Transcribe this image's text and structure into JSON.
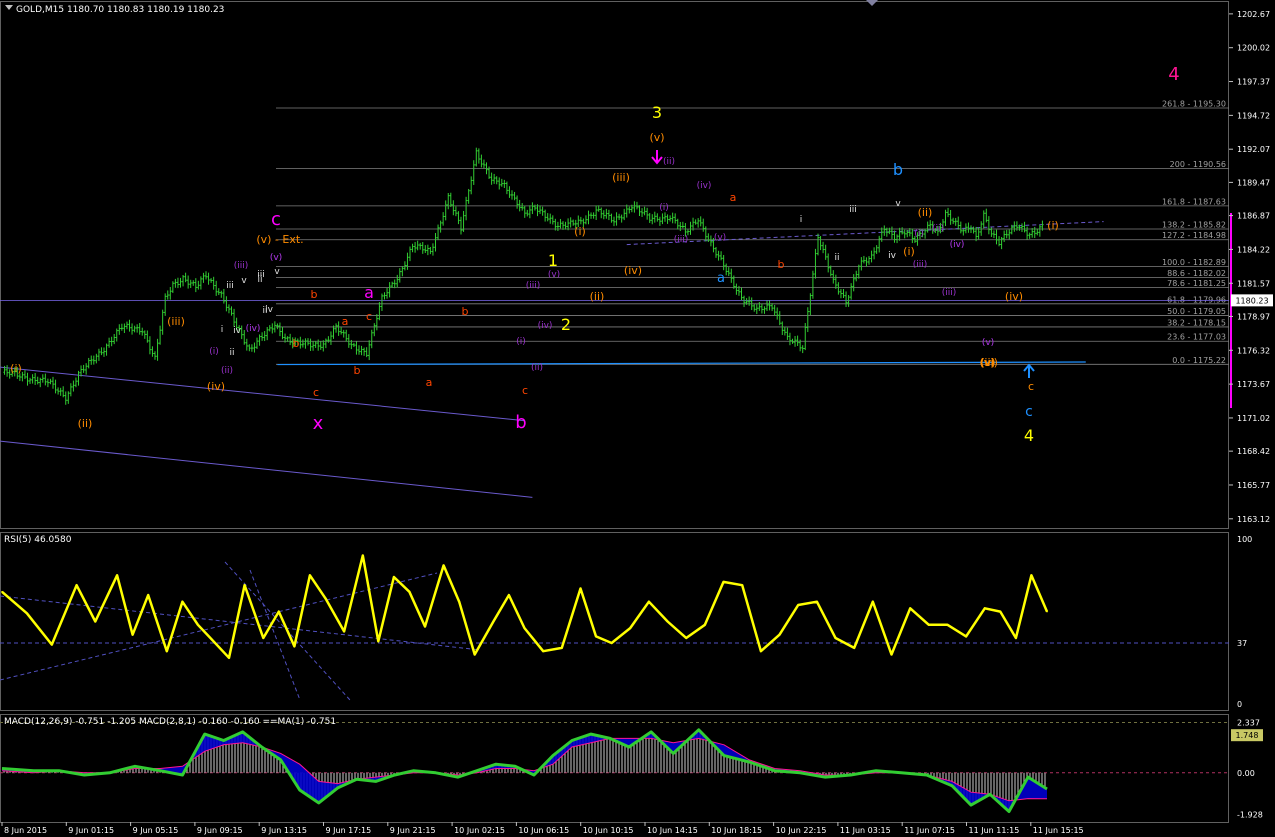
{
  "chart_data": [
    {
      "type": "candlestick",
      "title": "GOLD,M15  1180.70 1180.83 1180.19 1180.23",
      "symbol": "GOLD",
      "timeframe": "M15",
      "ohlc_header": {
        "open": 1180.7,
        "high": 1180.83,
        "low": 1180.19,
        "close": 1180.23
      },
      "current_price": 1180.23,
      "y_ticks": [
        1202.67,
        1200.02,
        1197.37,
        1194.72,
        1192.07,
        1189.47,
        1186.87,
        1184.22,
        1181.57,
        1178.97,
        1176.32,
        1173.67,
        1171.02,
        1168.42,
        1165.77,
        1163.12
      ],
      "ylim": [
        1162.4,
        1203.6
      ],
      "x_ticks": [
        "8 Jun 2015",
        "9 Jun 01:15",
        "9 Jun 05:15",
        "9 Jun 09:15",
        "9 Jun 13:15",
        "9 Jun 17:15",
        "9 Jun 21:15",
        "10 Jun 02:15",
        "10 Jun 06:15",
        "10 Jun 10:15",
        "10 Jun 14:15",
        "10 Jun 18:15",
        "10 Jun 22:15",
        "11 Jun 03:15",
        "11 Jun 07:15",
        "11 Jun 11:15",
        "11 Jun 15:15"
      ],
      "close_path_bar_index": [
        0,
        10,
        18,
        25,
        30,
        40,
        47,
        55,
        60,
        64,
        67,
        71,
        76,
        80,
        86,
        92,
        97,
        101,
        104,
        107,
        111,
        117,
        122,
        126,
        131,
        137,
        143,
        149,
        155,
        161,
        168,
        175,
        180,
        186,
        192,
        197,
        202,
        205,
        209,
        214,
        218,
        222,
        227,
        233,
        240,
        247,
        254,
        262,
        268,
        273,
        279,
        284,
        290,
        296,
        302,
        308,
        314,
        320,
        326,
        331,
        336,
        341,
        346,
        350,
        354,
        358,
        361,
        364,
        367,
        370,
        373,
        377,
        380,
        382,
        385,
        388,
        391,
        394,
        398,
        403,
        408
      ],
      "close_path_price": [
        1174.6,
        1174.2,
        1173.8,
        1172.7,
        1174.4,
        1176.5,
        1178.1,
        1178.0,
        1175.6,
        1180.3,
        1181.5,
        1182.0,
        1181.2,
        1182.2,
        1180.7,
        1178.1,
        1176.4,
        1177.3,
        1177.7,
        1178.2,
        1177.3,
        1176.9,
        1176.6,
        1176.8,
        1178.2,
        1176.6,
        1176.2,
        1180.3,
        1182.0,
        1184.5,
        1184.0,
        1188.3,
        1185.8,
        1191.9,
        1189.6,
        1189.2,
        1188.0,
        1187.0,
        1187.4,
        1186.8,
        1186.1,
        1186.1,
        1186.4,
        1187.3,
        1186.4,
        1187.7,
        1186.6,
        1186.8,
        1185.5,
        1186.7,
        1184.2,
        1182.6,
        1180.5,
        1179.4,
        1179.9,
        1177.2,
        1176.5,
        1185.3,
        1181.6,
        1180.2,
        1183.0,
        1183.5,
        1186.0,
        1185.2,
        1185.5,
        1185.0,
        1185.7,
        1186.2,
        1185.4,
        1186.9,
        1186.5,
        1185.8,
        1186.0,
        1185.0,
        1186.8,
        1185.5,
        1184.9,
        1185.5,
        1186.0,
        1185.4,
        1186.1
      ],
      "fibonacci_levels": [
        {
          "label": "261.8 - 1195.30",
          "price": 1195.3
        },
        {
          "label": "200 - 1190.56",
          "price": 1190.56
        },
        {
          "label": "161.8 - 1187.63",
          "price": 1187.63
        },
        {
          "label": "138.2 - 1185.82",
          "price": 1185.82
        },
        {
          "label": "127.2 - 1184.98",
          "price": 1184.98
        },
        {
          "label": "100.0 - 1182.89",
          "price": 1182.89
        },
        {
          "label": "88.6 - 1182.02",
          "price": 1182.02
        },
        {
          "label": "78.6 - 1181.25",
          "price": 1181.25
        },
        {
          "label": "61.8 - 1179.96",
          "price": 1179.96
        },
        {
          "label": "50.0 - 1179.05",
          "price": 1179.05
        },
        {
          "label": "38.2 - 1178.15",
          "price": 1178.15
        },
        {
          "label": "23.6 - 1177.03",
          "price": 1177.03
        },
        {
          "label": "0.0 - 1175.22",
          "price": 1175.22
        }
      ],
      "wave_labels": [
        {
          "text": "3",
          "color": "#ffff00"
        },
        {
          "text": "1",
          "color": "#ffff00"
        },
        {
          "text": "2",
          "color": "#ffff00"
        },
        {
          "text": "4",
          "color": "#ffff00"
        },
        {
          "text": "4",
          "color": "#ff1493"
        },
        {
          "text": "c",
          "color": "#ff00ff"
        },
        {
          "text": "a",
          "color": "#ff00ff"
        },
        {
          "text": "x",
          "color": "#ff00ff"
        },
        {
          "text": "b",
          "color": "#ff00ff"
        },
        {
          "text": "b",
          "color": "#1e90ff"
        },
        {
          "text": "a",
          "color": "#1e90ff"
        },
        {
          "text": "c",
          "color": "#1e90ff"
        },
        {
          "text": "(v) - Ext.",
          "color": "#ff8c00"
        },
        {
          "text": "(i)",
          "color": "#ff8c00"
        },
        {
          "text": "(ii)",
          "color": "#ff8c00"
        },
        {
          "text": "(iii)",
          "color": "#ff8c00"
        },
        {
          "text": "(iv)",
          "color": "#ff8c00"
        },
        {
          "text": "(v)",
          "color": "#ff8c00"
        },
        {
          "text": "(i)",
          "color": "#ff8c00"
        },
        {
          "text": "(ii)",
          "color": "#ff8c00"
        },
        {
          "text": "(iii)",
          "color": "#ff8c00"
        },
        {
          "text": "(iv)",
          "color": "#ff8c00"
        },
        {
          "text": "(v)",
          "color": "#ff8c00"
        },
        {
          "text": "c",
          "color": "#ff8c00"
        },
        {
          "text": "(ii)",
          "color": "#ff8c00"
        },
        {
          "text": "(i)",
          "color": "#ff8c00"
        },
        {
          "text": "(iii)",
          "color": "#ff8c00"
        },
        {
          "text": "(iv)",
          "color": "#ff8c00"
        },
        {
          "text": "(v)",
          "color": "#ff8c00"
        },
        {
          "text": "(i)",
          "color": "#ff8c00"
        },
        {
          "text": "b",
          "color": "#ff4500"
        },
        {
          "text": "b",
          "color": "#ff4500"
        },
        {
          "text": "c",
          "color": "#ff4500"
        },
        {
          "text": "a",
          "color": "#ff4500"
        },
        {
          "text": "c",
          "color": "#ff4500"
        },
        {
          "text": "b",
          "color": "#ff4500"
        },
        {
          "text": "a",
          "color": "#ff4500"
        },
        {
          "text": "b",
          "color": "#ff4500"
        },
        {
          "text": "c",
          "color": "#ff4500"
        },
        {
          "text": "a",
          "color": "#ff4500"
        },
        {
          "text": "b",
          "color": "#ff4500"
        },
        {
          "text": "(i)",
          "color": "#9932cc"
        },
        {
          "text": "(ii)",
          "color": "#9932cc"
        },
        {
          "text": "(iii)",
          "color": "#9932cc"
        },
        {
          "text": "(iv)",
          "color": "#9932cc"
        },
        {
          "text": "(v)",
          "color": "#9932cc"
        },
        {
          "text": "(i)",
          "color": "#9932cc"
        },
        {
          "text": "(ii)",
          "color": "#9932cc"
        },
        {
          "text": "(iii)",
          "color": "#9932cc"
        },
        {
          "text": "(iv)",
          "color": "#9932cc"
        },
        {
          "text": "(v)",
          "color": "#9932cc"
        },
        {
          "text": "(iii)",
          "color": "#9932cc"
        },
        {
          "text": "(iv)",
          "color": "#9932cc"
        },
        {
          "text": "(v)",
          "color": "#9932cc"
        },
        {
          "text": "(i)",
          "color": "#9932cc"
        },
        {
          "text": "(ii)",
          "color": "#9932cc"
        },
        {
          "text": "(iii)",
          "color": "#9932cc"
        },
        {
          "text": "(iv)",
          "color": "#9932cc"
        },
        {
          "text": "(v)",
          "color": "#9932cc"
        },
        {
          "text": "(ii)",
          "color": "#9932cc"
        },
        {
          "text": "(iii)",
          "color": "#9932cc"
        },
        {
          "text": "(iv)",
          "color": "#9932cc"
        },
        {
          "text": "(v)",
          "color": "#9932cc"
        },
        {
          "text": "(iv)",
          "color": "#9932cc"
        },
        {
          "text": "(v)",
          "color": "#9932cc"
        },
        {
          "text": "(i)",
          "color": "#9932cc"
        },
        {
          "text": "i",
          "color": "#e0e0e0"
        },
        {
          "text": "ii",
          "color": "#e0e0e0"
        },
        {
          "text": "iii",
          "color": "#e0e0e0"
        },
        {
          "text": "iv",
          "color": "#e0e0e0"
        },
        {
          "text": "v",
          "color": "#e0e0e0"
        },
        {
          "text": "ii",
          "color": "#e0e0e0"
        },
        {
          "text": "iii",
          "color": "#e0e0e0"
        },
        {
          "text": "iv",
          "color": "#e0e0e0"
        },
        {
          "text": "v",
          "color": "#e0e0e0"
        },
        {
          "text": "i",
          "color": "#e0e0e0"
        },
        {
          "text": "ii",
          "color": "#e0e0e0"
        },
        {
          "text": "iii",
          "color": "#e0e0e0"
        },
        {
          "text": "iv",
          "color": "#e0e0e0"
        },
        {
          "text": "v",
          "color": "#e0e0e0"
        },
        {
          "text": "ii",
          "color": "#e0e0e0"
        }
      ],
      "colors": {
        "price": "#32cd32",
        "fib": "#808080",
        "trendline": "#6a5acd",
        "support": "#1e90ff",
        "current_price_line": "#7b68ee"
      }
    },
    {
      "type": "line",
      "title": "RSI(5) 46.0580",
      "y_ticks": [
        100,
        37,
        0
      ],
      "ylim": [
        0,
        100
      ],
      "level": 37,
      "x_bar_index": [
        0,
        8,
        16,
        24,
        30,
        37,
        42,
        47,
        53,
        58,
        63,
        68,
        73,
        78,
        84,
        89,
        94,
        99,
        104,
        110,
        116,
        121,
        126,
        131,
        136,
        142,
        147,
        152,
        158,
        163,
        168,
        174,
        180,
        186,
        191,
        196,
        202,
        208,
        214,
        220,
        226,
        232,
        238,
        244,
        250,
        256,
        262,
        268,
        274,
        280,
        286,
        292,
        298,
        304,
        310,
        316,
        321,
        326,
        331,
        336
      ],
      "values": [
        68,
        55,
        36,
        72,
        50,
        78,
        42,
        66,
        32,
        62,
        48,
        38,
        28,
        72,
        40,
        56,
        35,
        78,
        64,
        44,
        90,
        38,
        77,
        68,
        47,
        84,
        62,
        30,
        50,
        66,
        46,
        32,
        34,
        70,
        41,
        37,
        46,
        62,
        50,
        40,
        48,
        74,
        72,
        32,
        42,
        60,
        62,
        40,
        34,
        62,
        30,
        58,
        48,
        48,
        41,
        58,
        56,
        40,
        78,
        56
      ],
      "color": "#ffff00"
    },
    {
      "type": "histogram+line",
      "title": "MACD(12,26,9) -0.751 -1.205  MACD(2,8,1) -0.160 -0.160  ==MA(1) -0.751",
      "y_ticks": [
        2.337,
        0.0,
        -1.928
      ],
      "ylim": [
        -2.1,
        2.5
      ],
      "current_value_label": "1.748",
      "x_bar_index": [
        0,
        10,
        18,
        26,
        34,
        42,
        50,
        57,
        64,
        70,
        76,
        82,
        88,
        94,
        100,
        106,
        112,
        118,
        124,
        130,
        137,
        144,
        150,
        156,
        162,
        168,
        174,
        180,
        186,
        192,
        198,
        205,
        212,
        220,
        228,
        236,
        244,
        252,
        260,
        268,
        276,
        284,
        292,
        300,
        306,
        312,
        318,
        324,
        330
      ],
      "fast_line": [
        0.2,
        0.1,
        0.1,
        -0.1,
        0.0,
        0.3,
        0.1,
        -0.1,
        1.8,
        1.5,
        1.9,
        1.2,
        0.6,
        -0.8,
        -1.4,
        -0.7,
        -0.3,
        -0.4,
        -0.1,
        0.1,
        0.0,
        -0.2,
        0.1,
        0.4,
        0.3,
        -0.1,
        0.8,
        1.5,
        1.8,
        1.6,
        1.2,
        1.9,
        0.9,
        2.0,
        0.8,
        0.5,
        0.1,
        0.0,
        -0.2,
        -0.1,
        0.1,
        0.0,
        -0.1,
        -0.6,
        -1.5,
        -1.0,
        -1.8,
        -0.2,
        -0.751
      ],
      "signal_line": [
        0.1,
        0.0,
        0.1,
        0.0,
        0.0,
        0.2,
        0.2,
        0.3,
        1.0,
        1.3,
        1.4,
        1.2,
        0.9,
        0.4,
        -0.4,
        -0.5,
        -0.3,
        -0.2,
        -0.1,
        0.0,
        0.0,
        -0.1,
        0.0,
        0.2,
        0.2,
        0.1,
        0.4,
        1.2,
        1.4,
        1.6,
        1.6,
        1.6,
        1.4,
        1.6,
        1.3,
        0.6,
        0.2,
        0.1,
        -0.1,
        -0.1,
        0.0,
        0.0,
        -0.1,
        -0.4,
        -0.9,
        -1.0,
        -1.3,
        -1.2,
        -1.205
      ],
      "colors": {
        "fast": "#32cd32",
        "signal": "#ff1493",
        "fill": "#0000cd",
        "hist": "#a9a9a9"
      }
    }
  ]
}
